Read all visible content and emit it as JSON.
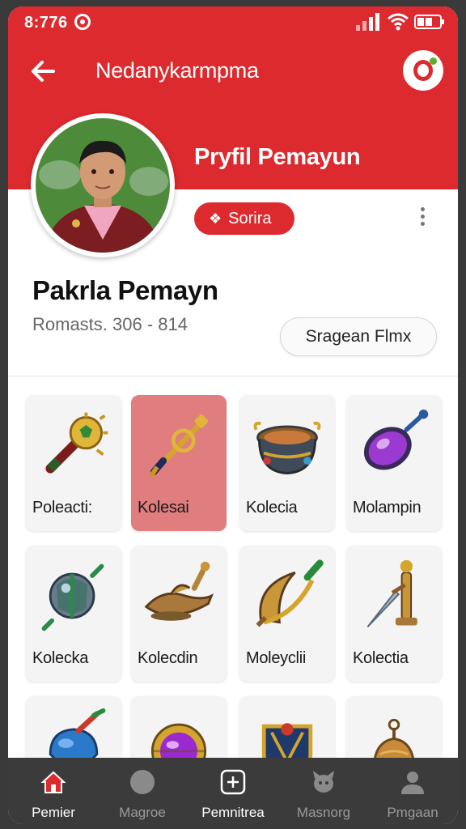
{
  "status_bar": {
    "time": "8:776"
  },
  "topbar": {
    "title": "Nedanykarmpma"
  },
  "profile": {
    "header_name": "Pryfil Pemayun",
    "role_badge": "Sorira",
    "player_name": "Pakrla Pemayn",
    "stats": "Romasts. 306 - 814",
    "action_button": "Sragean Flmx"
  },
  "collection": [
    {
      "label": "Poleacti:",
      "icon": "scepter-icon",
      "selected": false
    },
    {
      "label": "Kolesai",
      "icon": "golden-wand-icon",
      "selected": true
    },
    {
      "label": "Kolecia",
      "icon": "treasure-cauldron-icon",
      "selected": false
    },
    {
      "label": "Molampin",
      "icon": "purple-gem-spoon-icon",
      "selected": false
    },
    {
      "label": "Kolecka",
      "icon": "turtle-orb-icon",
      "selected": false
    },
    {
      "label": "Kolecdin",
      "icon": "magic-lamp-icon",
      "selected": false
    },
    {
      "label": "Moleyclii",
      "icon": "crescent-blade-icon",
      "selected": false
    },
    {
      "label": "Kolectia",
      "icon": "dagger-icon",
      "selected": false
    },
    {
      "label": "",
      "icon": "blue-spinning-top-icon",
      "selected": false
    },
    {
      "label": "",
      "icon": "purple-gem-ring-icon",
      "selected": false
    },
    {
      "label": "",
      "icon": "crest-shield-icon",
      "selected": false
    },
    {
      "label": "",
      "icon": "bronze-bell-icon",
      "selected": false
    }
  ],
  "bottom_nav": [
    {
      "label": "Pemier",
      "icon": "home-icon",
      "active": true
    },
    {
      "label": "Magroe",
      "icon": "circle-icon",
      "active": false
    },
    {
      "label": "Pemnitrea",
      "icon": "add-box-icon",
      "active": true
    },
    {
      "label": "Masnorg",
      "icon": "pet-icon",
      "active": false
    },
    {
      "label": "Pmgaan",
      "icon": "person-icon",
      "active": false
    }
  ],
  "colors": {
    "primary": "#dc2a2e",
    "selected_card": "#e07d7e",
    "nav_bg": "#3b3b3b"
  }
}
